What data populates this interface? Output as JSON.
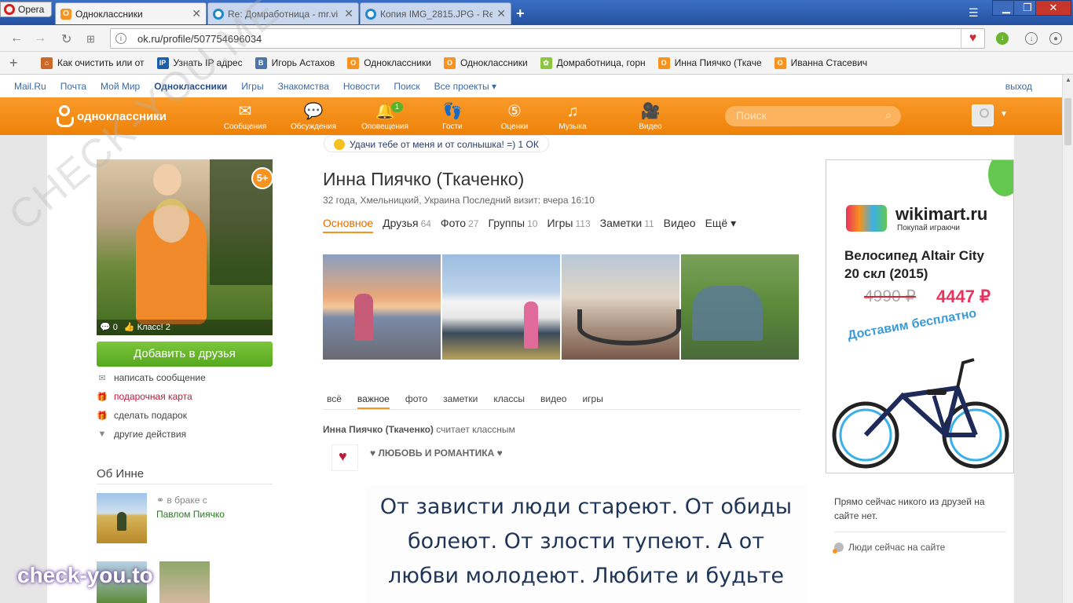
{
  "browser": {
    "opera_label": "Opera",
    "tabs": [
      {
        "title": "Одноклассники",
        "active": true
      },
      {
        "title": "Re: Домработница - mr.vi"
      },
      {
        "title": "Копия IMG_2815.JPG - Re:"
      }
    ],
    "url": "ok.ru/profile/507754696034"
  },
  "bookmarks": [
    {
      "label": "Как очистить или от",
      "icon": "house-icon"
    },
    {
      "label": "Узнать IP адрес",
      "icon": "ip-icon"
    },
    {
      "label": "Игорь Астахов",
      "icon": "vk-icon"
    },
    {
      "label": "Одноклассники",
      "icon": "ok-icon"
    },
    {
      "label": "Одноклассники",
      "icon": "ok-icon"
    },
    {
      "label": "Домработница, горн",
      "icon": "flower-icon"
    },
    {
      "label": "Инна Пиячко (Ткаче",
      "icon": "ok-icon"
    },
    {
      "label": "Иванна Стасевич",
      "icon": "ok-icon"
    }
  ],
  "portal": {
    "links": [
      "Mail.Ru",
      "Почта",
      "Мой Мир",
      "Одноклассники",
      "Игры",
      "Знакомства",
      "Новости",
      "Поиск",
      "Все проекты ▾"
    ],
    "logout": "выход"
  },
  "ok": {
    "logo_text": "одноклассники",
    "nav": [
      {
        "label": "Сообщения",
        "icon": "envelope-icon"
      },
      {
        "label": "Обсуждения",
        "icon": "chat-icon"
      },
      {
        "label": "Оповещения",
        "icon": "bell-icon",
        "badge": "1"
      },
      {
        "label": "Гости",
        "icon": "footprints-icon"
      },
      {
        "label": "Оценки",
        "icon": "rating-icon"
      },
      {
        "label": "Музыка",
        "icon": "music-icon"
      },
      {
        "label": "Видео",
        "icon": "video-icon"
      }
    ],
    "search_placeholder": "Поиск"
  },
  "profile": {
    "photo_stats": {
      "comments": "0",
      "likes": "Класс! 2"
    },
    "age_badge": "5+",
    "add_friend": "Добавить в друзья",
    "actions": [
      "написать сообщение",
      "подарочная карта",
      "сделать подарок",
      "другие действия"
    ],
    "status": "Удачи тебе от меня и от солнышка! =) 1 ОК",
    "name": "Инна Пиячко (Ткаченко)",
    "meta": "32 года, Хмельницкий, Украина  Последний визит: вчера 16:10",
    "tabs": [
      {
        "label": "Основное",
        "count": ""
      },
      {
        "label": "Друзья",
        "count": "64"
      },
      {
        "label": "Фото",
        "count": "27"
      },
      {
        "label": "Группы",
        "count": "10"
      },
      {
        "label": "Игры",
        "count": "113"
      },
      {
        "label": "Заметки",
        "count": "11"
      },
      {
        "label": "Видео",
        "count": ""
      },
      {
        "label": "Ещё ▾",
        "count": ""
      }
    ],
    "about_title": "Об Инне",
    "married_label": "в браке с",
    "spouse": "Павлом Пиячко"
  },
  "feed": {
    "tabs": [
      "всё",
      "важное",
      "фото",
      "заметки",
      "классы",
      "видео",
      "игры"
    ],
    "who_name": "Инна Пиячко (Ткаченко)",
    "who_action": " считает классным",
    "group": "♥ ЛЮБОВЬ И РОМАНТИКА ♥",
    "quote_lines": [
      "От зависти люди стареют. От обиды",
      "болеют. От злости тупеют. А от",
      "любви молодеют. Любите и будьте"
    ]
  },
  "ad": {
    "brand": "wikimart.ru",
    "slogan": "Покупай играючи",
    "model": "Велосипед Altair City 20 скл (2015)",
    "old_price": "4990 ₽",
    "new_price": "4447 ₽",
    "delivery": "Доставим бесплатно"
  },
  "online": {
    "text": "Прямо сейчас никого из друзей на сайте нет.",
    "link": "Люди сейчас на сайте"
  },
  "watermark": {
    "bottom": "check-you.to",
    "diagonal": "CHECK-YOU.ME"
  },
  "colors": {
    "ok_orange": "#f7931e",
    "add_green": "#59b32a",
    "link_blue": "#3a6aa8"
  }
}
